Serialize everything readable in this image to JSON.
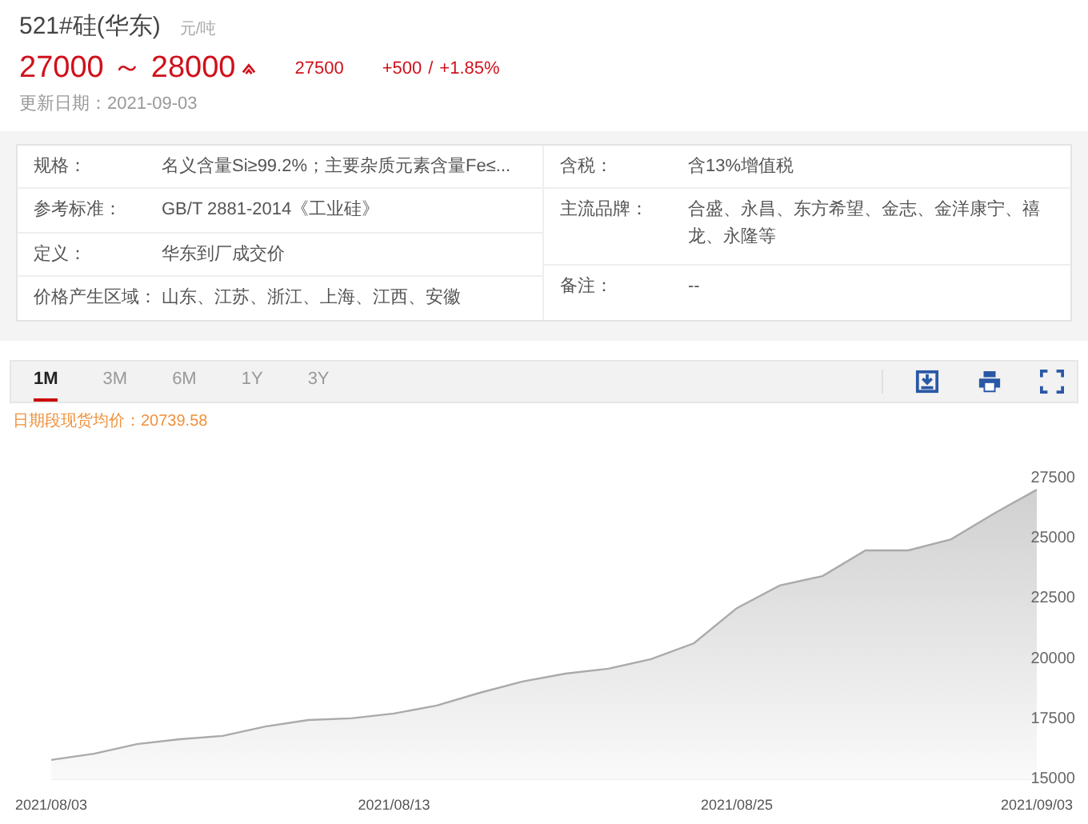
{
  "header": {
    "title": "521#硅(华东)",
    "unit": "元/吨",
    "price_range": "27000 ～ 28000",
    "trend_up": true,
    "average": "27500",
    "change": "+500",
    "separator": "/",
    "change_pct": "+1.85%",
    "updated": "更新日期：2021-09-03"
  },
  "specs_left": [
    {
      "label": "规格：",
      "value": "名义含量Si≥99.2%；主要杂质元素含量Fe≤..."
    },
    {
      "label": "参考标准：",
      "value": "GB/T 2881-2014《工业硅》"
    },
    {
      "label": "定义：",
      "value": "华东到厂成交价"
    },
    {
      "label": "价格产生区域：",
      "value": "山东、江苏、浙江、上海、江西、安徽"
    }
  ],
  "specs_right": [
    {
      "label": "含税：",
      "value": "含13%增值税"
    },
    {
      "label": "主流品牌：",
      "value": "合盛、永昌、东方希望、金志、金洋康宁、禧龙、永隆等"
    },
    {
      "label": "备注：",
      "value": "--"
    }
  ],
  "tabs": [
    {
      "label": "1M",
      "selected": true
    },
    {
      "label": "3M",
      "selected": false
    },
    {
      "label": "6M",
      "selected": false
    },
    {
      "label": "1Y",
      "selected": false
    },
    {
      "label": "3Y",
      "selected": false
    }
  ],
  "legend": "日期段现货均价：20739.58",
  "chart_data": {
    "type": "area",
    "categories": [
      "2021/08/03",
      null,
      null,
      null,
      null,
      null,
      null,
      null,
      "2021/08/13",
      null,
      null,
      null,
      null,
      null,
      null,
      null,
      "2021/08/25",
      null,
      null,
      null,
      null,
      null,
      null,
      "2021/09/03"
    ],
    "series": [
      {
        "color": "#aaaaaa",
        "values": [
          15800,
          16060,
          16460,
          16660,
          16800,
          17190,
          17460,
          17530,
          17730,
          18060,
          18590,
          19060,
          19390,
          19590,
          19990,
          20650,
          22110,
          23050,
          23440,
          24510,
          24510,
          24970,
          26040,
          27030
        ]
      }
    ],
    "ylim": [
      15000,
      27500
    ],
    "yticks": [
      15000,
      17500,
      20000,
      22500,
      25000,
      27500
    ]
  }
}
